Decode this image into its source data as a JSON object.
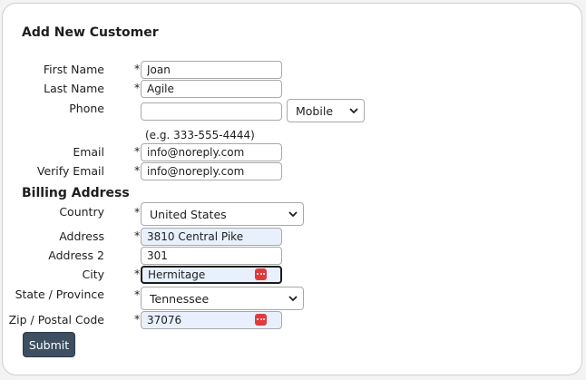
{
  "form": {
    "title": "Add New Customer",
    "section_billing": "Billing Address",
    "required_mark": "*",
    "submit_label": "Submit"
  },
  "fields": {
    "first_name": {
      "label": "First Name",
      "value": "Joan"
    },
    "last_name": {
      "label": "Last Name",
      "value": "Agile"
    },
    "phone": {
      "label": "Phone",
      "value": "",
      "type_selected": "Mobile",
      "hint": "(e.g. 333-555-4444)"
    },
    "email": {
      "label": "Email",
      "value": "info@noreply.com"
    },
    "verify_email": {
      "label": "Verify Email",
      "value": "info@noreply.com"
    },
    "country": {
      "label": "Country",
      "selected": "United States"
    },
    "address": {
      "label": "Address",
      "value": "3810 Central Pike"
    },
    "address2": {
      "label": "Address 2",
      "value": "301"
    },
    "city": {
      "label": "City",
      "value": "Hermitage"
    },
    "state": {
      "label": "State / Province",
      "selected": "Tennessee"
    },
    "zip": {
      "label": "Zip / Postal Code",
      "value": "37076"
    }
  },
  "colors": {
    "autofill_bg": "#e8f0fe",
    "submit_bg": "#3e4f61",
    "password_manager_icon": "#e03b3b"
  }
}
